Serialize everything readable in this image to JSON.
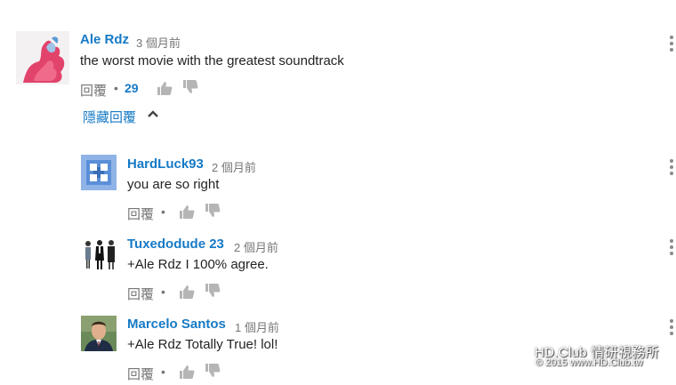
{
  "comments": [
    {
      "author": "Ale Rdz",
      "time": "3 個月前",
      "text": "the worst movie with the greatest soundtrack",
      "reply_label": "回覆",
      "dot": "•",
      "likes": "29",
      "avatar": "ink-cloud-avatar"
    },
    {
      "author": "HardLuck93",
      "time": "2 個月前",
      "text": "you are so right",
      "reply_label": "回覆",
      "dot": "•",
      "avatar": "blue-pattern-avatar"
    },
    {
      "author": "Tuxedodude 23",
      "time": "2 個月前",
      "text": "+Ale Rdz I 100% agree.",
      "reply_label": "回覆",
      "dot": "•",
      "avatar": "figures-avatar"
    },
    {
      "author": "Marcelo Santos",
      "time": "1 個月前",
      "text": "+Ale Rdz Totally True! lol!",
      "reply_label": "回覆",
      "dot": "•",
      "avatar": "photo-avatar"
    }
  ],
  "hide_replies_label": "隱藏回覆",
  "watermark": {
    "line1": "HD.Club 情研視務所",
    "line2": "© 2015  www.HD.Club.tw"
  },
  "colors": {
    "link_blue": "#167ac6",
    "meta_gray": "#767676",
    "icon_gray": "#b5b5b5"
  }
}
